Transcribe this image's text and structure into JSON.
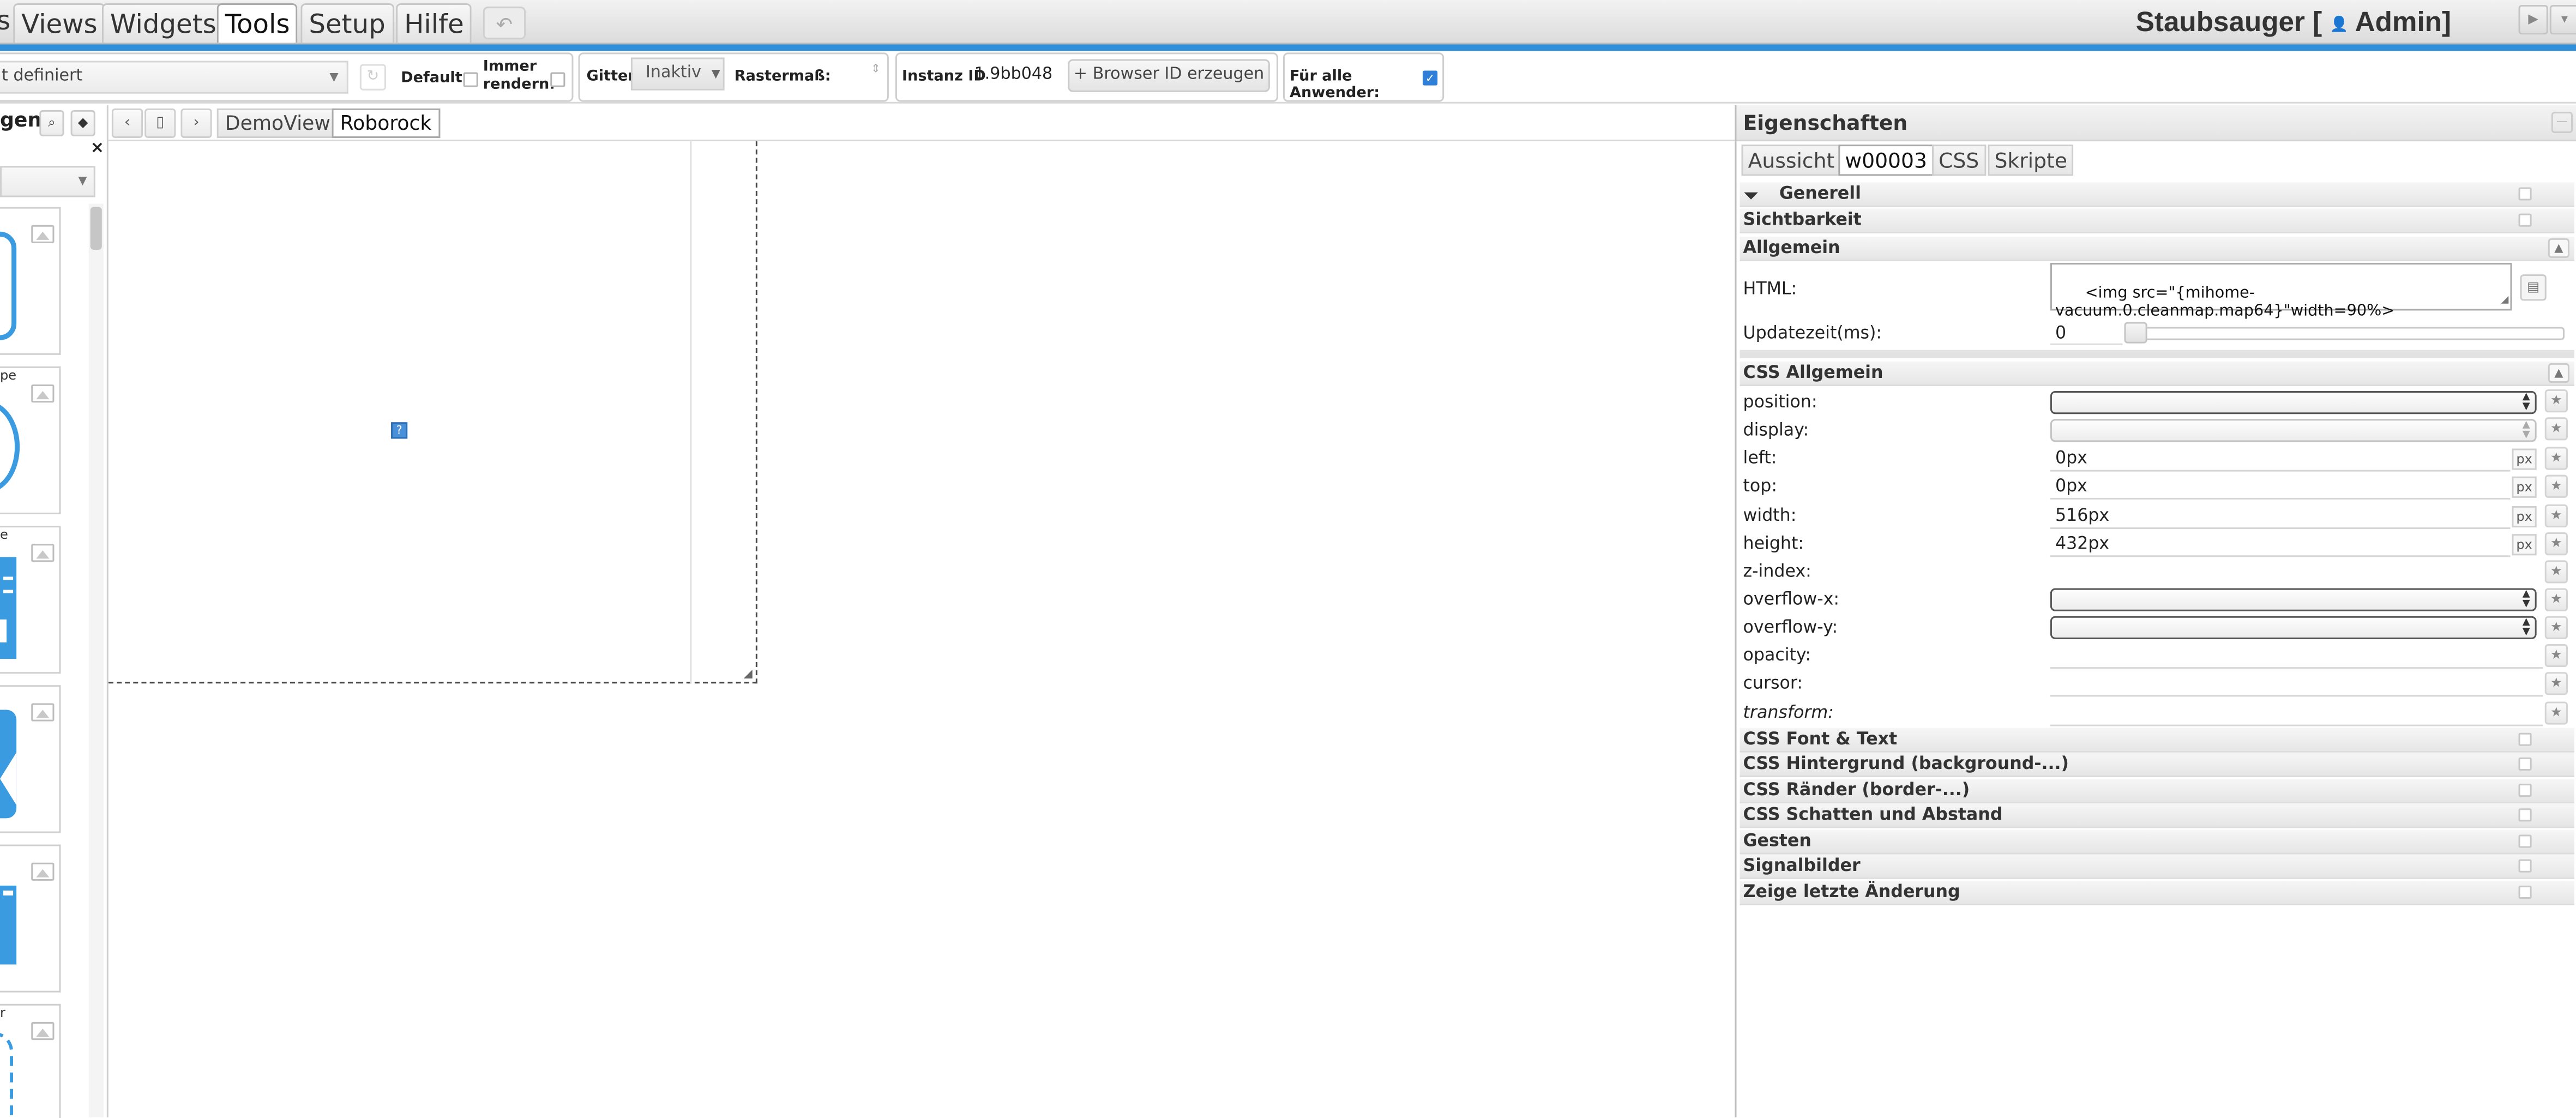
{
  "menubar": {
    "cut_char": "s",
    "tabs": [
      {
        "label": "Views"
      },
      {
        "label": "Widgets"
      },
      {
        "label": "Tools"
      },
      {
        "label": "Setup"
      },
      {
        "label": "Hilfe"
      }
    ],
    "active_tab": "Tools",
    "undo_icon": "undo-icon",
    "title_prefix": "Staubsauger [",
    "title_user": "Admin]",
    "win_buttons": [
      "play-icon",
      "dropdown-icon"
    ]
  },
  "toolbar": {
    "view_select_value": "t definiert",
    "default_label": "Default:",
    "immer_label_1": "Immer",
    "immer_label_2": "rendern:",
    "gitter_label": "Gitter",
    "gitter_value": "Inaktiv",
    "rastermass_label": "Rastermaß:",
    "instanz_label": "Instanz ID",
    "instanz_value": "1.9bb048",
    "browser_id_button": "Browser ID erzeugen",
    "fuer_alle_label": "Für alle Anwender:",
    "fuer_alle_checked": true
  },
  "leftpanel": {
    "title": "gen",
    "close": "×",
    "cards": [
      {
        "label": ""
      },
      {
        "label": "pe"
      },
      {
        "label": "e"
      },
      {
        "label": ""
      },
      {
        "label": ""
      },
      {
        "label": "r"
      }
    ]
  },
  "viewtabs": {
    "tabs": [
      "DemoView",
      "Roborock"
    ],
    "active": "Roborock"
  },
  "canvas": {
    "broken_image_glyph": "?"
  },
  "properties": {
    "title": "Eigenschaften",
    "tabs": [
      "Aussicht",
      "w00003",
      "CSS",
      "Skripte"
    ],
    "active_tab": "w00003",
    "sections_top": [
      {
        "label": "Generell"
      },
      {
        "label": "Sichtbarkeit"
      },
      {
        "label": "Allgemein"
      }
    ],
    "html_label": "HTML:",
    "html_value": "<img src=\"{mihome-\nvacuum.0.cleanmap.map64}\"width=90%>",
    "updatezeit_label": "Updatezeit(ms):",
    "updatezeit_value": "0",
    "css_allgemein_label": "CSS Allgemein",
    "css_props": [
      {
        "label": "position:",
        "value": "",
        "kind": "select"
      },
      {
        "label": "display:",
        "value": "",
        "kind": "select-disabled"
      },
      {
        "label": "left:",
        "value": "0px",
        "kind": "unit"
      },
      {
        "label": "top:",
        "value": "0px",
        "kind": "unit"
      },
      {
        "label": "width:",
        "value": "516px",
        "kind": "unit"
      },
      {
        "label": "height:",
        "value": "432px",
        "kind": "unit"
      },
      {
        "label": "z-index:",
        "value": "",
        "kind": "plain"
      },
      {
        "label": "overflow-x:",
        "value": "",
        "kind": "select"
      },
      {
        "label": "overflow-y:",
        "value": "",
        "kind": "select"
      },
      {
        "label": "opacity:",
        "value": "",
        "kind": "plain-long"
      },
      {
        "label": "cursor:",
        "value": "",
        "kind": "plain-long"
      },
      {
        "label": "transform:",
        "value": "",
        "kind": "plain-long-italic"
      }
    ],
    "unit_label": "px",
    "sections_bottom": [
      {
        "label": "CSS Font & Text"
      },
      {
        "label": "CSS Hintergrund (background-...)"
      },
      {
        "label": "CSS Ränder (border-...)"
      },
      {
        "label": "CSS Schatten und Abstand"
      },
      {
        "label": "Gesten"
      },
      {
        "label": "Signalbilder"
      },
      {
        "label": "Zeige letzte Änderung"
      }
    ]
  },
  "colors": {
    "accent": "#2f8fd9",
    "widget_blue": "#3a9be0"
  }
}
